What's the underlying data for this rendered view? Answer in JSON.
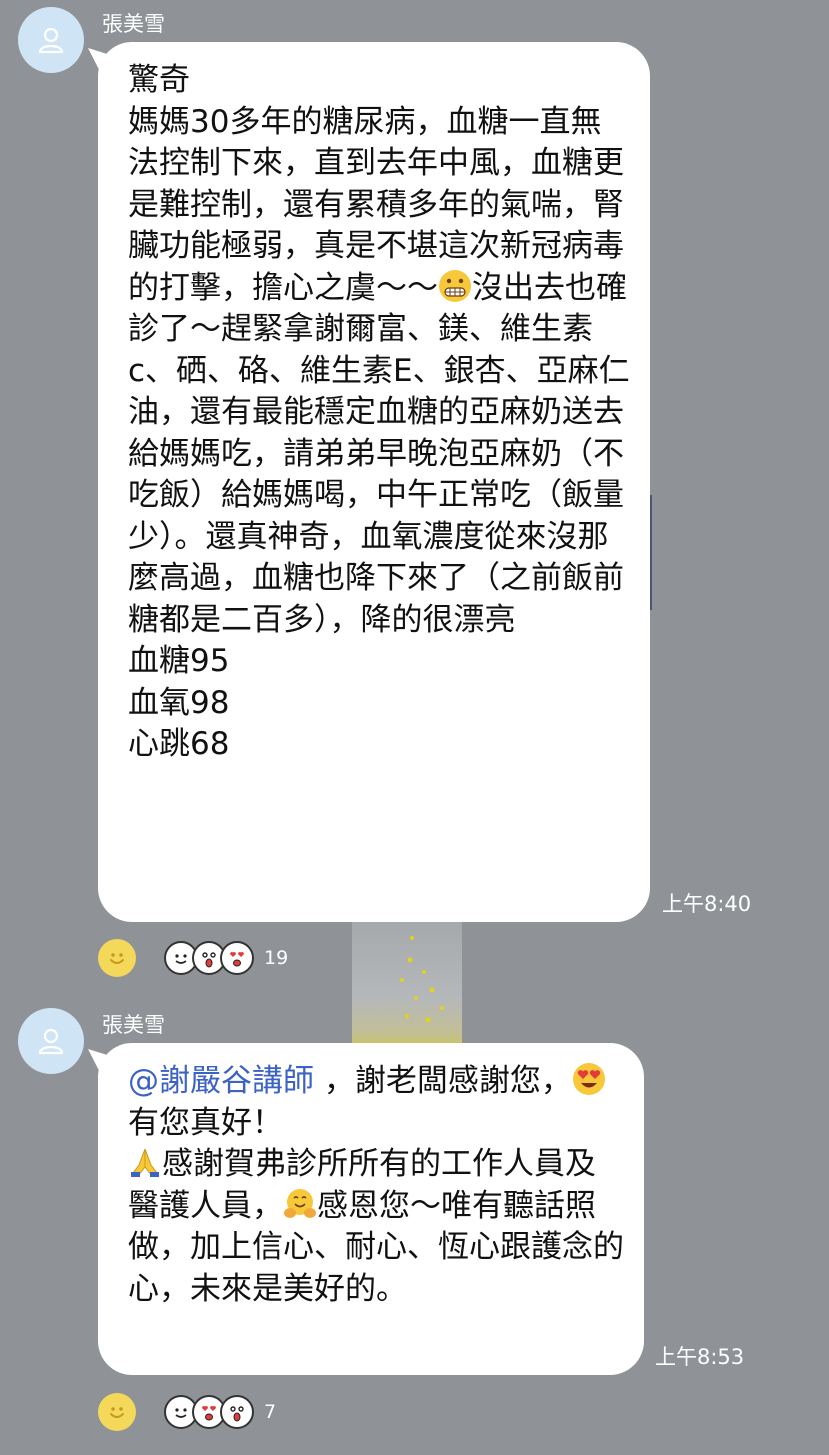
{
  "messages": [
    {
      "sender": "張美雪",
      "text": "驚奇\n媽媽30多年的糖尿病，血糖一直無法控制下來，直到去年中風，血糖更是難控制，還有累積多年的氣喘，腎臟功能極弱，真是不堪這次新冠病毒的打擊，擔心之虞～～",
      "text_after_emoji": "沒出去也確診了～趕緊拿謝爾富、鎂、維生素c、硒、硌、維生素E、銀杏、亞麻仁油，還有最能穩定血糖的亞麻奶送去給媽媽吃，請弟弟早晚泡亞麻奶（不吃飯）給媽媽喝，中午正常吃（飯量少）。還真神奇，血氧濃度從來沒那麼高過，血糖也降下來了（之前飯前糖都是二百多），降的很漂亮\n血糖95\n血氧98\n心跳68",
      "emoji": "grimacing-face",
      "time": "上午8:40",
      "reaction_count": "19",
      "reaction_stickers": [
        "thumbs-up-sticker",
        "surprised-sticker",
        "heart-eyes-sticker"
      ]
    },
    {
      "sender": "張美雪",
      "mention": "@謝嚴谷講師",
      "text_1": " ，謝老闆感謝您，",
      "emoji_1": "heart-eyes-face",
      "text_2": "有您真好！\n",
      "emoji_2": "folded-hands",
      "text_3": "感謝賀弗診所所有的工作人員及醫護人員，",
      "emoji_3": "hugging-face",
      "text_4": "感恩您～唯有聽話照做，加上信心、耐心、恆心跟護念的心，未來是美好的。",
      "time": "上午8:53",
      "reaction_count": "7",
      "reaction_stickers": [
        "thumbs-up-sticker",
        "heart-eyes-sticker",
        "surprised-sticker"
      ]
    }
  ],
  "colors": {
    "background": "#8f9397",
    "bubble": "#ffffff",
    "mention": "#3c63c4",
    "avatar": "#cfe4f5"
  }
}
